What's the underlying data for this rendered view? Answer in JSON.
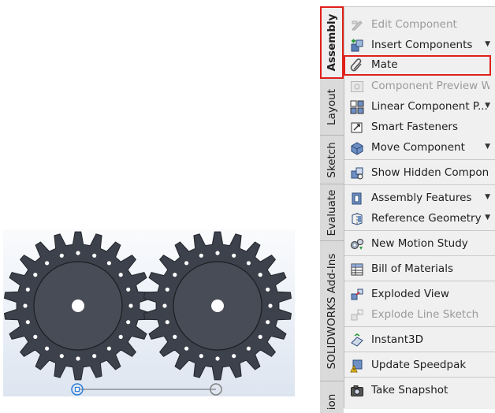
{
  "tabs": [
    {
      "label": "Assembly",
      "active": true
    },
    {
      "label": "Layout",
      "active": false
    },
    {
      "label": "Sketch",
      "active": false
    },
    {
      "label": "Evaluate",
      "active": false
    },
    {
      "label": "SOLIDWORKS Add-Ins",
      "active": false
    },
    {
      "label": "ion",
      "active": false
    }
  ],
  "commands": [
    {
      "label": "Edit Component",
      "icon": "edit-component-icon",
      "disabled": true,
      "dropdown": false
    },
    {
      "label": "Insert Components",
      "icon": "insert-components-icon",
      "disabled": false,
      "dropdown": true
    },
    {
      "label": "Mate",
      "icon": "mate-icon",
      "disabled": false,
      "dropdown": false,
      "highlighted": true
    },
    {
      "label": "Component Preview Wi...",
      "icon": "component-preview-icon",
      "disabled": true,
      "dropdown": false
    },
    {
      "label": "Linear Component P...",
      "icon": "linear-pattern-icon",
      "disabled": false,
      "dropdown": true
    },
    {
      "label": "Smart Fasteners",
      "icon": "smart-fasteners-icon",
      "disabled": false,
      "dropdown": false
    },
    {
      "label": "Move Component",
      "icon": "move-component-icon",
      "disabled": false,
      "dropdown": true
    },
    {
      "label": "Show Hidden Compone...",
      "icon": "show-hidden-icon",
      "disabled": false,
      "dropdown": false
    },
    {
      "label": "Assembly Features",
      "icon": "assembly-features-icon",
      "disabled": false,
      "dropdown": true
    },
    {
      "label": "Reference Geometry",
      "icon": "reference-geometry-icon",
      "disabled": false,
      "dropdown": true
    },
    {
      "label": "New Motion Study",
      "icon": "motion-study-icon",
      "disabled": false,
      "dropdown": false
    },
    {
      "label": "Bill of Materials",
      "icon": "bill-of-materials-icon",
      "disabled": false,
      "dropdown": false
    },
    {
      "label": "Exploded View",
      "icon": "exploded-view-icon",
      "disabled": false,
      "dropdown": false
    },
    {
      "label": "Explode Line Sketch",
      "icon": "explode-line-sketch-icon",
      "disabled": true,
      "dropdown": false
    },
    {
      "label": "Instant3D",
      "icon": "instant3d-icon",
      "disabled": false,
      "dropdown": false
    },
    {
      "label": "Update Speedpak",
      "icon": "update-speedpak-icon",
      "disabled": false,
      "dropdown": false
    },
    {
      "label": "Take Snapshot",
      "icon": "take-snapshot-icon",
      "disabled": false,
      "dropdown": false
    }
  ],
  "colors": {
    "highlight_border": "#e0201a",
    "gear_fill": "#3d414b",
    "panel_bg": "#f0f0f0"
  }
}
